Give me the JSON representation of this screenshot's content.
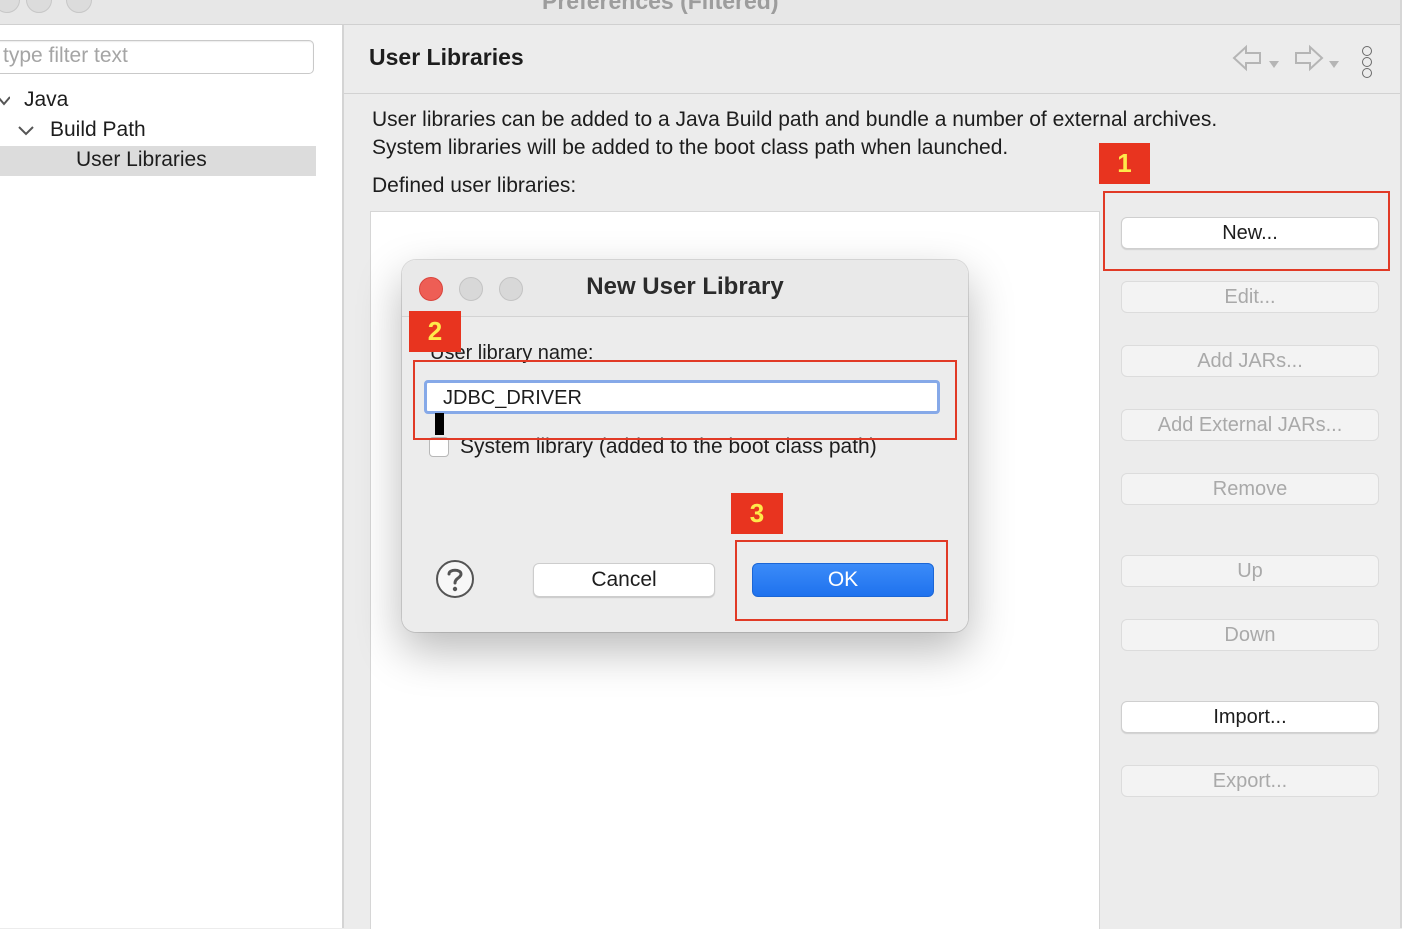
{
  "window": {
    "title": "Preferences (Filtered)"
  },
  "sidebar": {
    "filter_placeholder": "type filter text",
    "tree": [
      {
        "label": "Java"
      },
      {
        "label": "Build Path"
      },
      {
        "label": "User Libraries",
        "selected": true
      }
    ]
  },
  "page": {
    "title": "User Libraries",
    "description_line1": "User libraries can be added to a Java Build path and bundle a number of external archives.",
    "description_line2": "System libraries will be added to the boot class path when launched.",
    "defined_label": "Defined user libraries:",
    "buttons": {
      "new": "New...",
      "edit": "Edit...",
      "add_jars": "Add JARs...",
      "add_external_jars": "Add External JARs...",
      "remove": "Remove",
      "up": "Up",
      "down": "Down",
      "import": "Import...",
      "export": "Export..."
    }
  },
  "dialog": {
    "title": "New User Library",
    "name_label": "User library name:",
    "name_value": "JDBC_DRIVER",
    "system_library_label": "System library (added to the boot class path)",
    "system_library_checked": false,
    "cancel": "Cancel",
    "ok": "OK"
  },
  "annotations": {
    "step1": "1",
    "step2": "2",
    "step3": "3",
    "color": "#e8341f",
    "text_color": "#ffe94a"
  }
}
